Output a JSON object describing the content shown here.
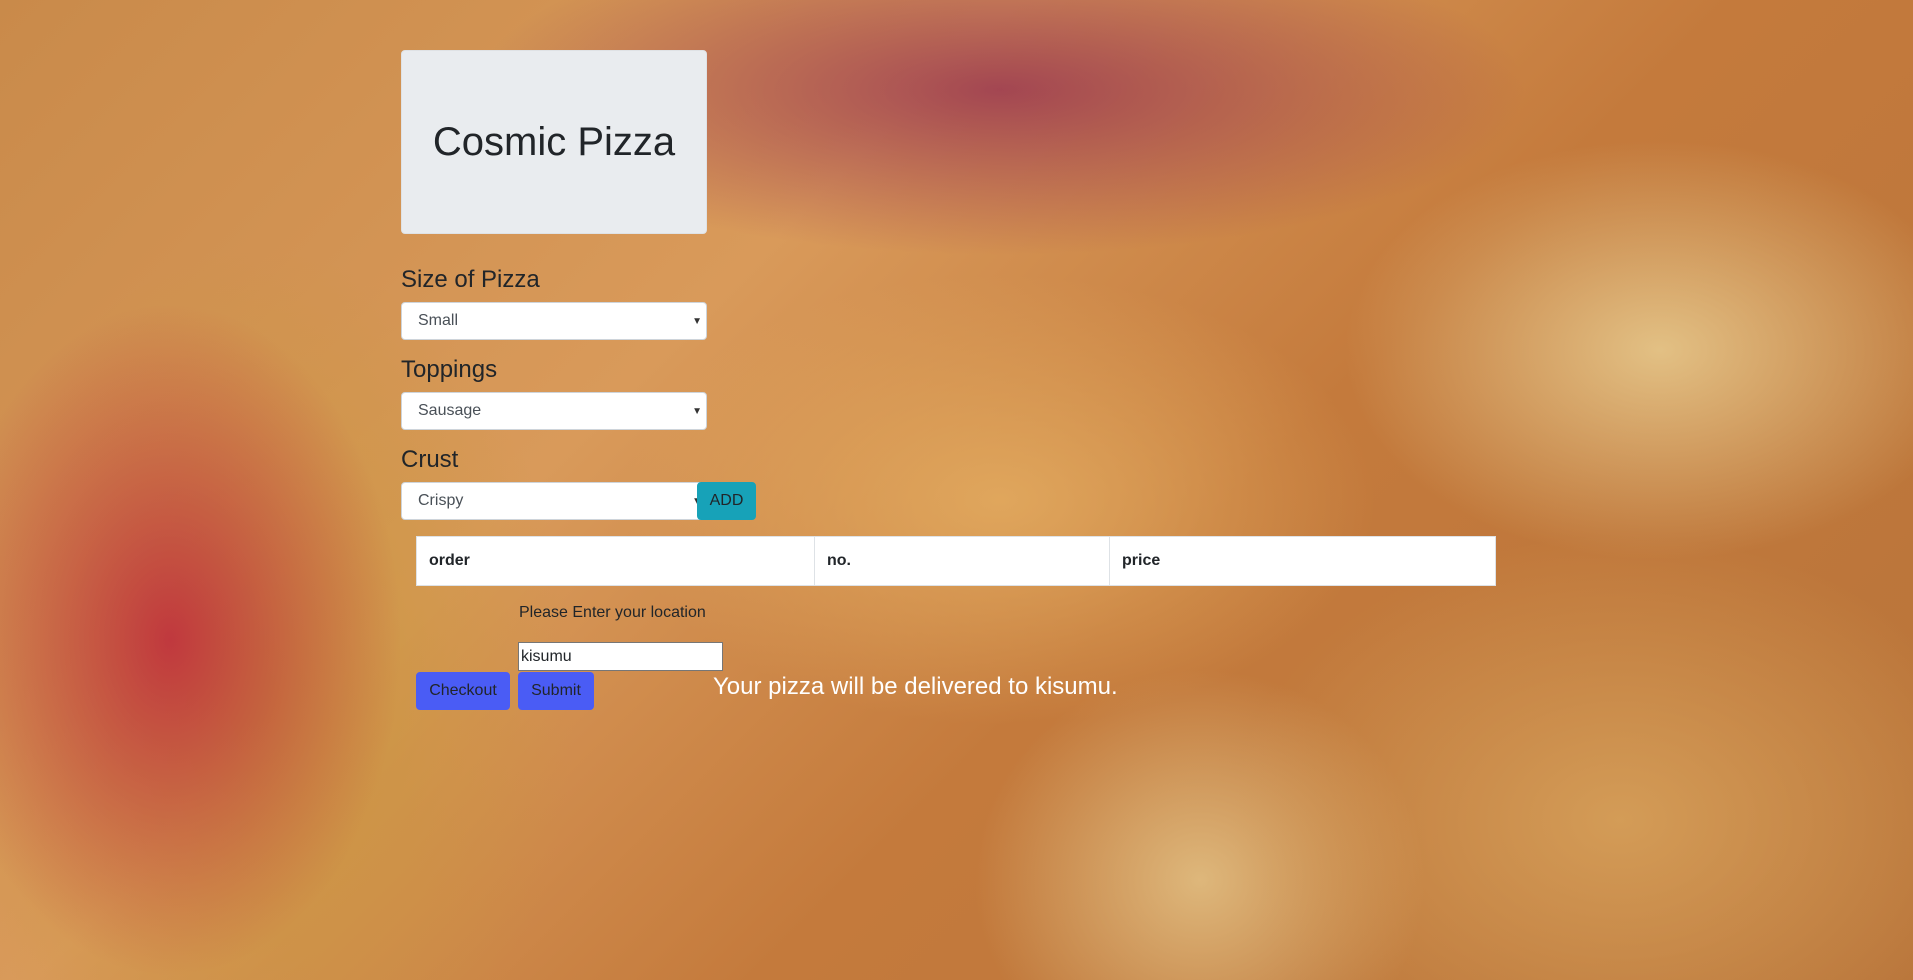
{
  "header": {
    "title": "Cosmic Pizza"
  },
  "form": {
    "size": {
      "label": "Size of Pizza",
      "selected": "Small"
    },
    "toppings": {
      "label": "Toppings",
      "selected": "Sausage"
    },
    "crust": {
      "label": "Crust",
      "selected": "Crispy"
    },
    "add_label": "ADD"
  },
  "order_table": {
    "columns": [
      "order",
      "no.",
      "price"
    ]
  },
  "checkout": {
    "location_label": "Please Enter your location",
    "location_value": "kisumu",
    "checkout_label": "Checkout",
    "submit_label": "Submit",
    "delivery_message": "Your pizza will be delivered to kisumu."
  },
  "colors": {
    "add_button": "#17a2b8",
    "blue_button": "#4a5cf5",
    "jumbotron": "#e9ecef"
  }
}
